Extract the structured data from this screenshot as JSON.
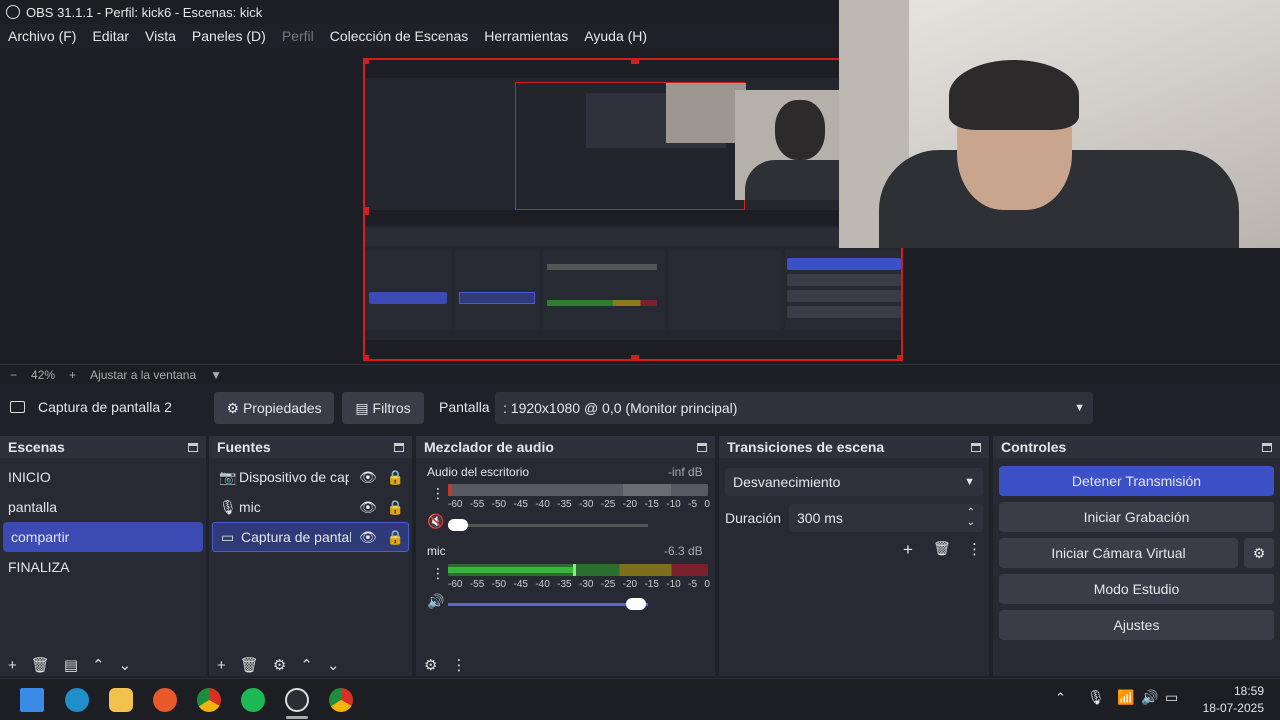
{
  "window": {
    "title": "OBS 31.1.1 - Perfil: kick6 - Escenas: kick"
  },
  "menu": [
    "Archivo (F)",
    "Editar",
    "Vista",
    "Paneles (D)",
    "Perfil",
    "Colección de Escenas",
    "Herramientas",
    "Ayuda (H)"
  ],
  "zoom": {
    "minus": "−",
    "value": "42%",
    "plus": "+",
    "fit": "Ajustar a la ventana",
    "arrow": "▼"
  },
  "source_bar": {
    "source_name": "Captura de pantalla 2",
    "properties": "Propiedades",
    "filters": "Filtros",
    "screen_label": "Pantalla",
    "screen_value": ": 1920x1080 @ 0,0 (Monitor principal)"
  },
  "scenes": {
    "title": "Escenas",
    "items": [
      "INICIO",
      "pantalla",
      "compartir",
      "FINALIZA"
    ],
    "active": 2
  },
  "sources": {
    "title": "Fuentes",
    "items": [
      "Dispositivo de cap",
      "mic",
      "Captura de pantall"
    ]
  },
  "mixer": {
    "title": "Mezclador de audio",
    "tracks": [
      {
        "name": "Audio del escritorio",
        "level": "-inf dB",
        "fill": 0.0
      },
      {
        "name": "mic",
        "level": "-6.3 dB",
        "fill": 0.48
      }
    ],
    "ticks": [
      "-60",
      "-55",
      "-50",
      "-45",
      "-40",
      "-35",
      "-30",
      "-25",
      "-20",
      "-15",
      "-10",
      "-5",
      "0"
    ]
  },
  "transitions": {
    "title": "Transiciones de escena",
    "selected": "Desvanecimiento",
    "duration_label": "Duración",
    "duration_value": "300 ms"
  },
  "controls": {
    "title": "Controles",
    "buttons": [
      "Detener Transmisión",
      "Iniciar Grabación",
      "Iniciar Cámara Virtual",
      "Modo Estudio",
      "Ajustes"
    ]
  },
  "taskbar": {
    "time": "18:59",
    "date": "18-07-2025"
  },
  "colors": {
    "accent": "#3c50c8",
    "selection": "#d21e1e"
  }
}
